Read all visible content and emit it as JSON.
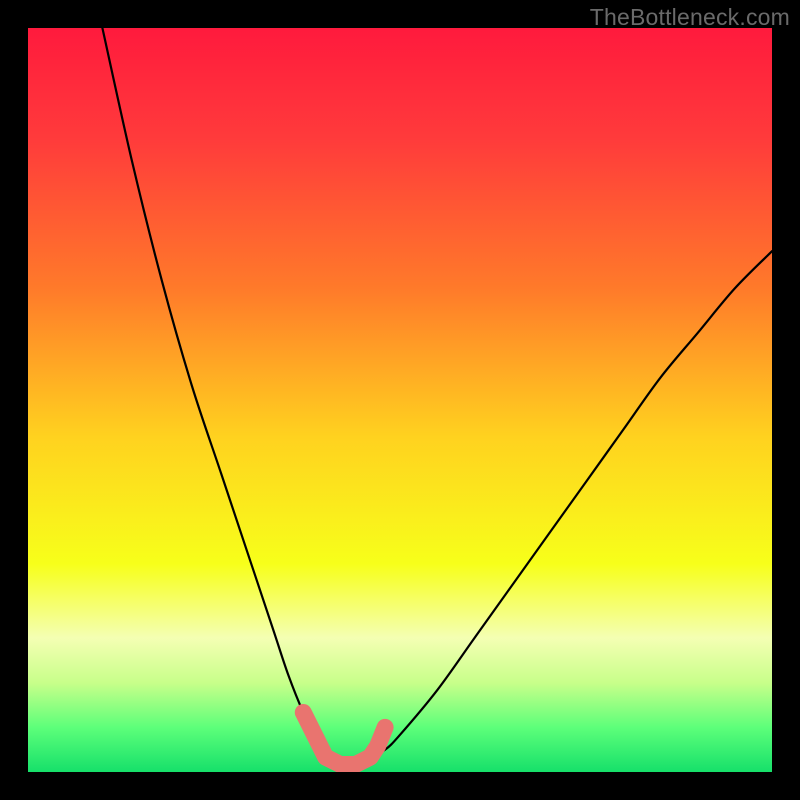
{
  "watermark": "TheBottleneck.com",
  "chart_data": {
    "type": "line",
    "title": "",
    "xlabel": "",
    "ylabel": "",
    "xlim": [
      0,
      100
    ],
    "ylim": [
      0,
      100
    ],
    "curve": {
      "name": "bottleneck-curve",
      "x": [
        10,
        14,
        18,
        22,
        26,
        30,
        33,
        35,
        37,
        39,
        40,
        42,
        44,
        46,
        48,
        50,
        55,
        60,
        65,
        70,
        75,
        80,
        85,
        90,
        95,
        100
      ],
      "y": [
        100,
        82,
        66,
        52,
        40,
        28,
        19,
        13,
        8,
        4,
        2,
        1,
        1,
        2,
        3,
        5,
        11,
        18,
        25,
        32,
        39,
        46,
        53,
        59,
        65,
        70
      ]
    },
    "highlight": {
      "name": "optimal-range",
      "x": [
        37,
        38.5,
        40,
        42,
        44,
        46,
        47,
        48
      ],
      "y": [
        8,
        5,
        2,
        1,
        1,
        2,
        3.5,
        6
      ]
    },
    "gradient_stops": [
      {
        "offset": 0.0,
        "color": "#ff1a3d"
      },
      {
        "offset": 0.15,
        "color": "#ff3b3b"
      },
      {
        "offset": 0.35,
        "color": "#ff7a2a"
      },
      {
        "offset": 0.55,
        "color": "#ffd21f"
      },
      {
        "offset": 0.72,
        "color": "#f7ff1a"
      },
      {
        "offset": 0.82,
        "color": "#f4ffb3"
      },
      {
        "offset": 0.88,
        "color": "#c8ff8a"
      },
      {
        "offset": 0.94,
        "color": "#5dff7a"
      },
      {
        "offset": 1.0,
        "color": "#16e06a"
      }
    ]
  }
}
